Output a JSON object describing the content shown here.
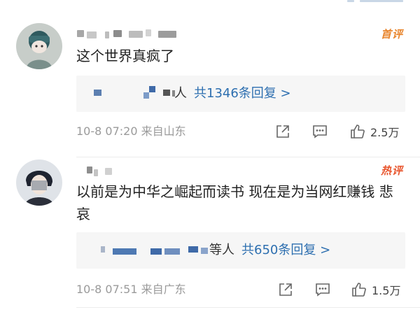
{
  "icons": {
    "share": "share-icon",
    "comment": "comment-icon",
    "like": "thumbs-up-icon"
  },
  "colors": {
    "link": "#2d6fb0",
    "first_tag": "#e8852d",
    "hot_tag": "#e8552d",
    "meta_gray": "#9a9a9a",
    "reply_bg": "#f6f6f6"
  },
  "comments": [
    {
      "tag": "首评",
      "text": "这个世界真疯了",
      "reply_suffix": "人",
      "reply_count_text": "共1346条回复 >",
      "time_location": "10-8 07:20 来自山东",
      "likes": "2.5万"
    },
    {
      "tag": "热评",
      "text": "以前是为中华之崛起而读书 现在是为当网红赚钱 悲哀",
      "reply_suffix": "等人",
      "reply_count_text": "共650条回复 >",
      "time_location": "10-8 07:51 来自广东",
      "likes": "1.5万"
    }
  ]
}
